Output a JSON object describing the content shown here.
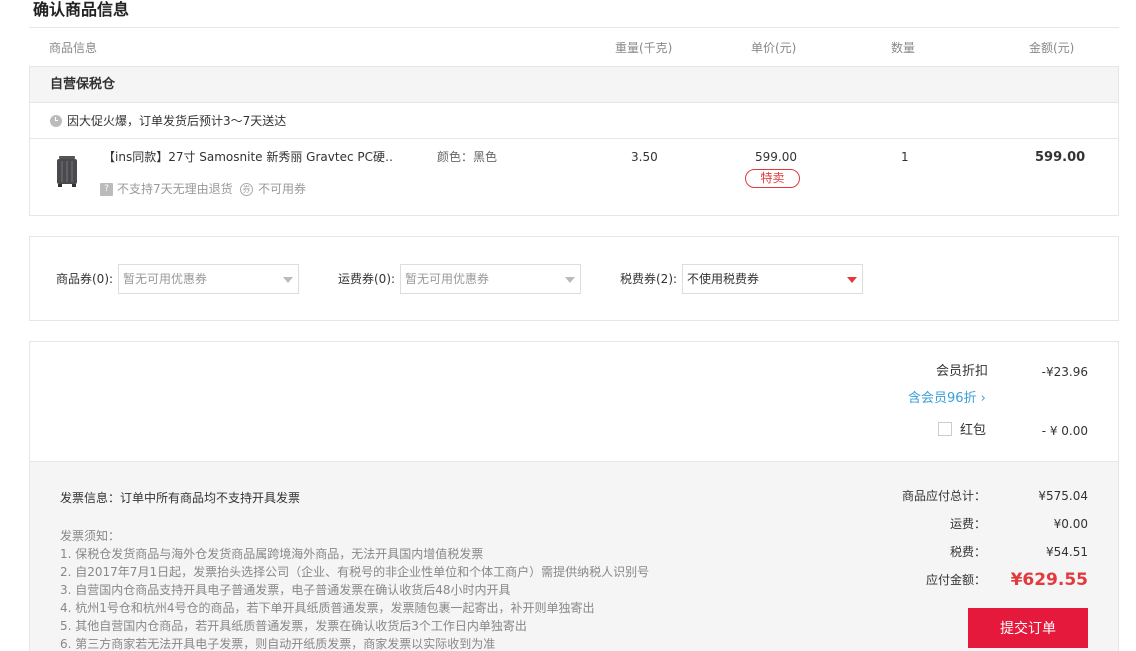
{
  "page_title": "确认商品信息",
  "columns": {
    "info": "商品信息",
    "weight": "重量(千克)",
    "unit_price": "单价(元)",
    "quantity": "数量",
    "amount": "金额(元)"
  },
  "warehouse": "自营保税仓",
  "delivery_notice": "因大促火爆，订单发货后预计3～7天送达",
  "item": {
    "name": "【ins同款】27寸 Samosnite 新秀丽 Gravtec PC硬…",
    "color": "颜色：黑色",
    "no_return_flag": "不支持7天无理由退货",
    "no_coupon_flag": "不可用券",
    "weight": "3.50",
    "unit_price": "599.00",
    "special_tag": "特卖",
    "quantity": "1",
    "amount": "599.00"
  },
  "coupons": {
    "goods_label": "商品券(0):",
    "goods_value": "暂无可用优惠券",
    "shipping_label": "运费券(0):",
    "shipping_value": "暂无可用优惠券",
    "tax_label": "税费券(2):",
    "tax_value": "不使用税费券"
  },
  "discounts": {
    "member_label": "会员折扣",
    "member_value": "-¥23.96",
    "vip_link": "含会员96折 ›",
    "redpacket_label": "红包",
    "redpacket_value": "- ¥ 0.00"
  },
  "invoice": {
    "info": "发票信息：订单中所有商品均不支持开具发票",
    "notice_title": "发票须知：",
    "notices": [
      "1. 保税仓发货商品与海外仓发货商品属跨境海外商品，无法开具国内增值税发票",
      "2. 自2017年7月1日起，发票抬头选择公司（企业、有税号的非企业性单位和个体工商户）需提供纳税人识别号",
      "3. 自营国内仓商品支持开具电子普通发票，电子普通发票在确认收货后48小时内开具",
      "4. 杭州1号仓和杭州4号仓的商品，若下单开具纸质普通发票，发票随包裹一起寄出，补开则单独寄出",
      "5. 其他自营国内仓商品，若开具纸质普通发票，发票在确认收货后3个工作日内单独寄出",
      "6. 第三方商家若无法开具电子发票，则自动开纸质发票，商家发票以实际收到为准"
    ]
  },
  "totals": {
    "goods_label": "商品应付总计：",
    "goods_value": "¥575.04",
    "shipping_label": "运费：",
    "shipping_value": "¥0.00",
    "tax_label": "税费：",
    "tax_value": "¥54.51",
    "payable_label": "应付金额：",
    "payable_value": "¥629.55"
  },
  "submit_label": "提交订单",
  "colors": {
    "accent_red": "#e4393c",
    "link_blue": "#3a9fd8"
  }
}
